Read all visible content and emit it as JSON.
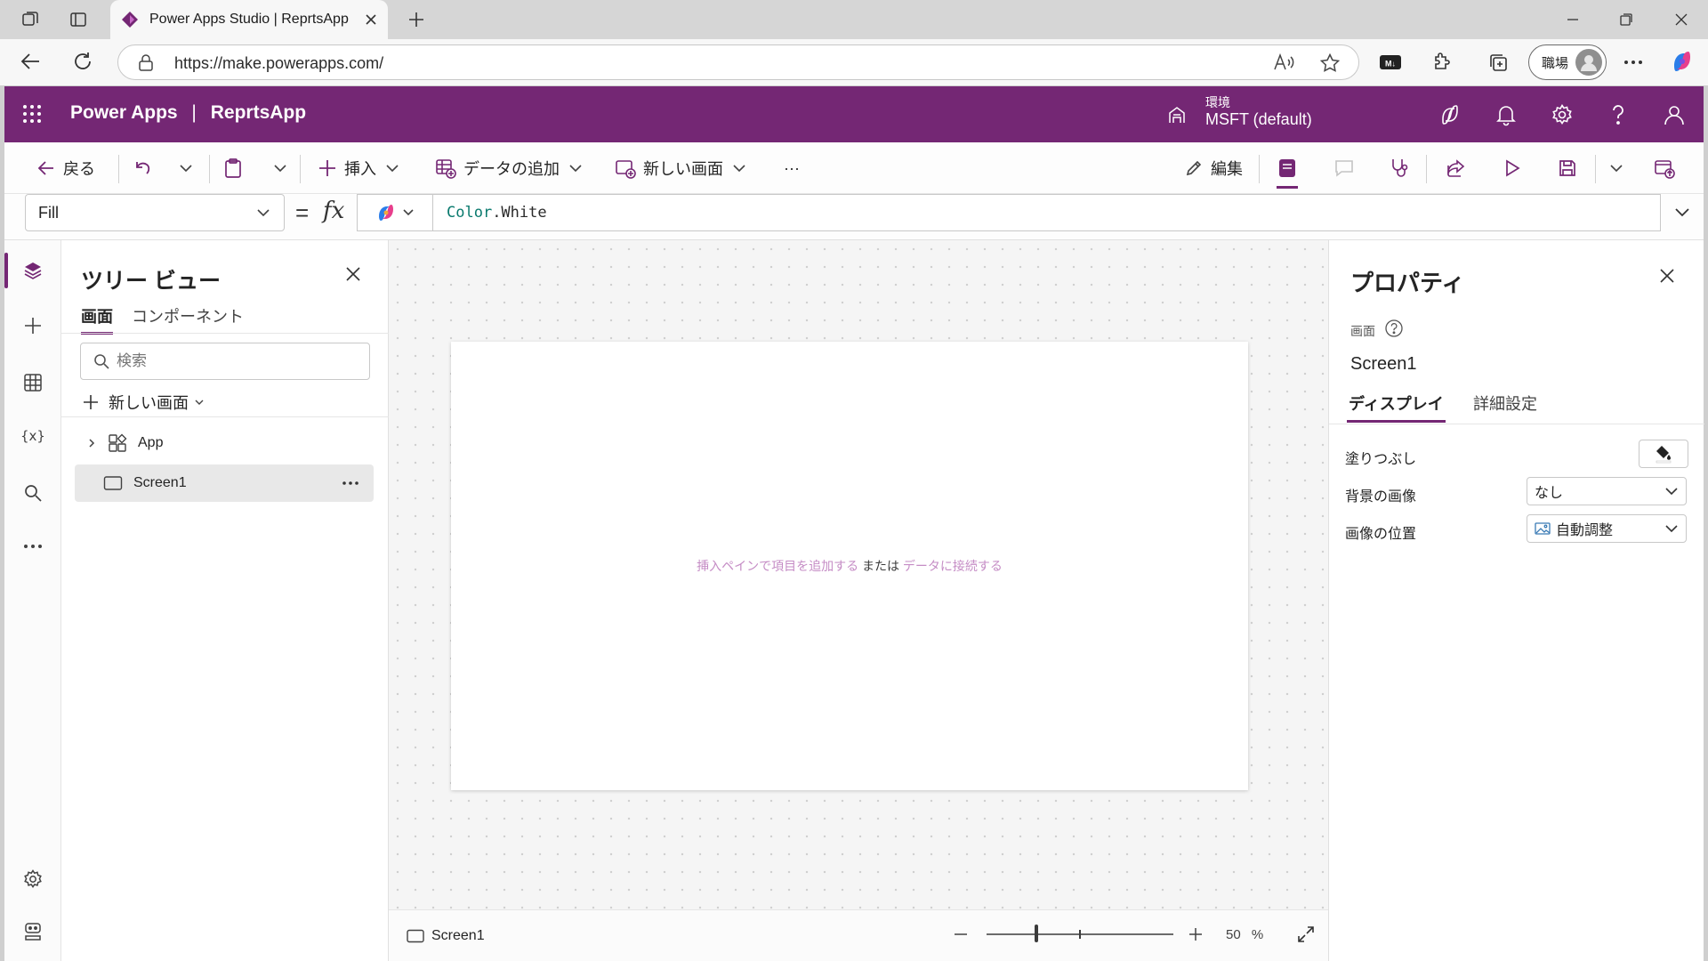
{
  "browser": {
    "tab_title": "Power Apps Studio | ReprtsApp",
    "url": "https://make.powerapps.com/",
    "profile_label": "職場"
  },
  "header": {
    "app_title": "Power Apps",
    "separator": "|",
    "app_name": "ReprtsApp",
    "environment_label": "環境",
    "environment_value": "MSFT (default)"
  },
  "commandbar": {
    "back_label": "戻る",
    "insert_label": "挿入",
    "add_data_label": "データの追加",
    "new_screen_label": "新しい画面",
    "more_label": "···",
    "edit_label": "編集"
  },
  "formula": {
    "property": "Fill",
    "equals": "=",
    "fx": "fx",
    "object": "Color",
    "member": ".White"
  },
  "treeview": {
    "title": "ツリー ビュー",
    "tabs": [
      "画面",
      "コンポーネント"
    ],
    "search_placeholder": "検索",
    "new_screen_label": "新しい画面",
    "items": [
      {
        "label": "App"
      },
      {
        "label": "Screen1"
      }
    ]
  },
  "canvas": {
    "hint_link1": "挿入ペインで項目を追加する",
    "hint_or": " または ",
    "hint_link2": "データに接続する"
  },
  "statusbar": {
    "screen_label": "Screen1",
    "zoom_value": "50",
    "zoom_unit": "%",
    "zoom_fraction": 0.5
  },
  "properties": {
    "title": "プロパティ",
    "object_type": "画面",
    "object_name": "Screen1",
    "tabs": [
      "ディスプレイ",
      "詳細設定"
    ],
    "rows": [
      {
        "label": "塗りつぶし"
      },
      {
        "label": "背景の画像",
        "value": "なし"
      },
      {
        "label": "画像の位置",
        "value": "自動調整"
      }
    ]
  },
  "colors": {
    "brand": "#742774",
    "link_hint": "#c58cc5",
    "formula_keyword": "#0a7a6e"
  }
}
